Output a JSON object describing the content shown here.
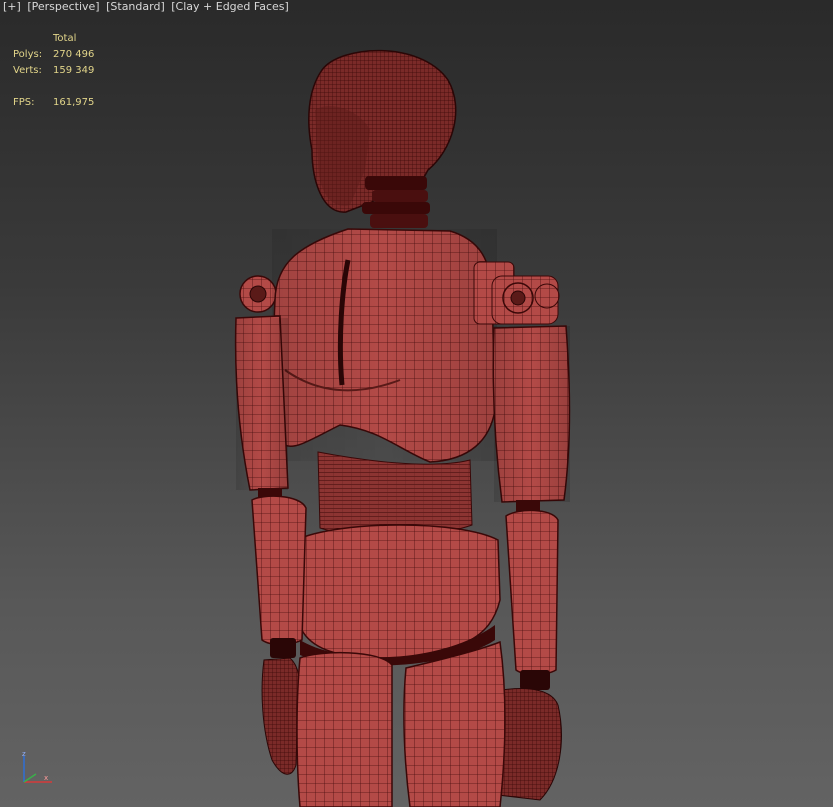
{
  "viewport": {
    "labels": [
      "[+]",
      "[Perspective]",
      "[Standard]",
      "[Clay + Edged Faces]"
    ]
  },
  "stats": {
    "header": "Total",
    "polys_label": "Polys:",
    "polys_value": "270 496",
    "verts_label": "Verts:",
    "verts_value": "159 349",
    "fps_label": "FPS:",
    "fps_value": "161,975"
  },
  "gizmo": {
    "z": "z",
    "x": "x"
  },
  "colors": {
    "clay": "#b34a47",
    "clay_shadow": "#7a2a28",
    "wire": "#4a0f0f",
    "stats_text": "#e2d58a",
    "label_text": "#d8d8d8"
  }
}
